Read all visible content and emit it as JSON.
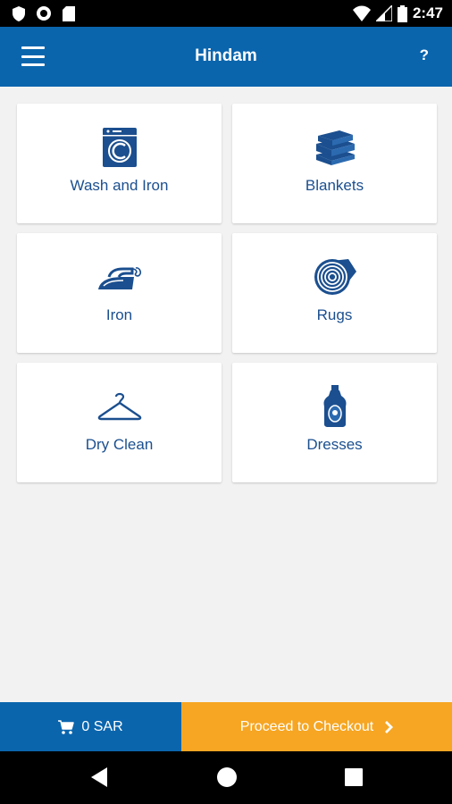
{
  "status_bar": {
    "time": "2:47",
    "icons": [
      "shield-icon",
      "circle-record-icon",
      "sd-card-icon",
      "wifi-icon",
      "signal-icon",
      "battery-icon"
    ]
  },
  "app_bar": {
    "title": "Hindam",
    "menu_icon": "menu-icon",
    "help_label": "?"
  },
  "services": [
    {
      "label": "Wash and Iron",
      "icon": "washing-machine-icon"
    },
    {
      "label": "Blankets",
      "icon": "blankets-icon"
    },
    {
      "label": "Iron",
      "icon": "iron-icon"
    },
    {
      "label": "Rugs",
      "icon": "rug-roll-icon"
    },
    {
      "label": "Dry Clean",
      "icon": "hanger-icon"
    },
    {
      "label": "Dresses",
      "icon": "detergent-bottle-icon"
    }
  ],
  "footer": {
    "cart_amount": "0 SAR",
    "checkout_label": "Proceed to Checkout"
  },
  "nav": {
    "icons": [
      "back-icon",
      "home-icon",
      "recents-icon"
    ]
  },
  "colors": {
    "primary": "#0a65ad",
    "accent": "#f6a623",
    "icon_blue": "#1b4f8f",
    "background": "#f2f2f2"
  }
}
